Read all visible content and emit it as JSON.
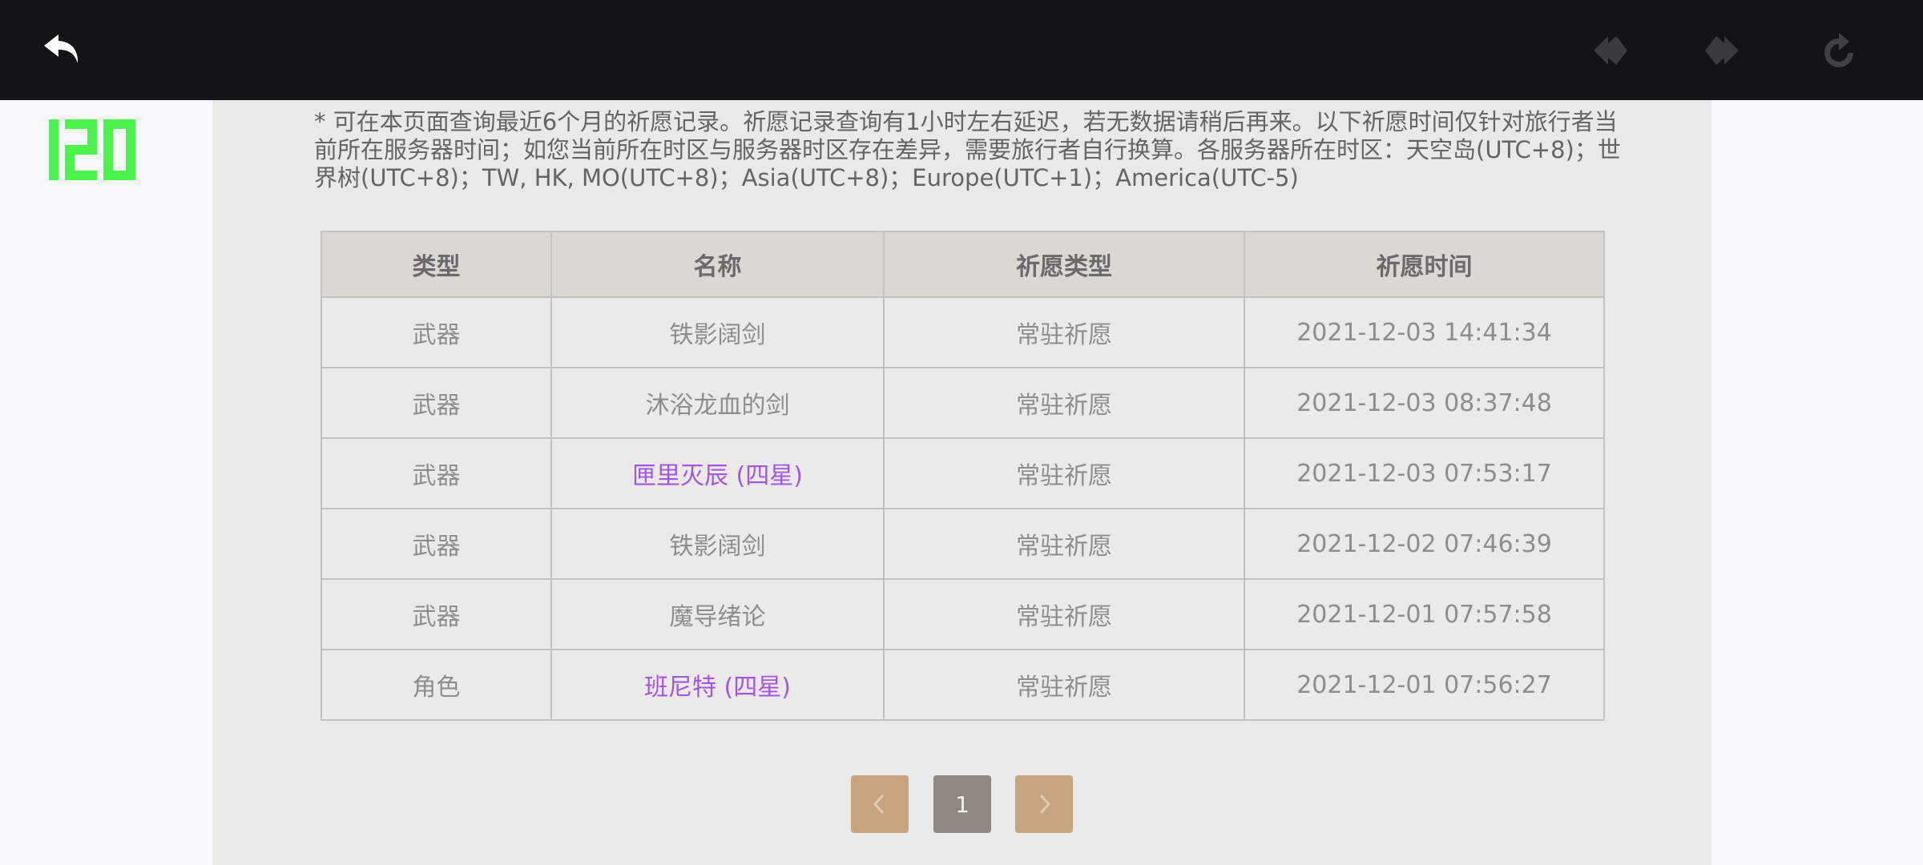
{
  "colors": {
    "topbar_bg": "#131416",
    "panel_bg": "#e9e9e9",
    "header_bg": "#dbd8d3",
    "four_star_purple": "#a256e1",
    "pager_tan": "#c7a47e",
    "pager_current": "#908780",
    "fps_green": "#4cf34c"
  },
  "topbar": {
    "icons": [
      "back-arrow-icon",
      "prev-diamond-arrow-icon",
      "next-diamond-arrow-icon",
      "reload-icon"
    ]
  },
  "fps_overlay": "120",
  "notice": "* 可在本页面查询最近6个月的祈愿记录。祈愿记录查询有1小时左右延迟，若无数据请稍后再来。以下祈愿时间仅针对旅行者当前所在服务器时间；如您当前所在时区与服务器时区存在差异，需要旅行者自行换算。各服务器所在时区：天空岛(UTC+8)；世界树(UTC+8)；TW, HK, MO(UTC+8)；Asia(UTC+8)；Europe(UTC+1)；America(UTC-5)",
  "table": {
    "headers": [
      "类型",
      "名称",
      "祈愿类型",
      "祈愿时间"
    ],
    "rows": [
      {
        "type": "武器",
        "name": "铁影阔剑",
        "wish_type": "常驻祈愿",
        "time": "2021-12-03 14:41:34"
      },
      {
        "type": "武器",
        "name": "沐浴龙血的剑",
        "wish_type": "常驻祈愿",
        "time": "2021-12-03 08:37:48"
      },
      {
        "type": "武器",
        "name": "匣里灭辰 (四星)",
        "wish_type": "常驻祈愿",
        "time": "2021-12-03 07:53:17"
      },
      {
        "type": "武器",
        "name": "铁影阔剑",
        "wish_type": "常驻祈愿",
        "time": "2021-12-02 07:46:39"
      },
      {
        "type": "武器",
        "name": "魔导绪论",
        "wish_type": "常驻祈愿",
        "time": "2021-12-01 07:57:58"
      },
      {
        "type": "角色",
        "name": "班尼特 (四星)",
        "wish_type": "常驻祈愿",
        "time": "2021-12-01 07:56:27"
      }
    ]
  },
  "pagination": {
    "prev_icon": "chevron-left-icon",
    "current_page": "1",
    "next_icon": "chevron-right-icon"
  }
}
